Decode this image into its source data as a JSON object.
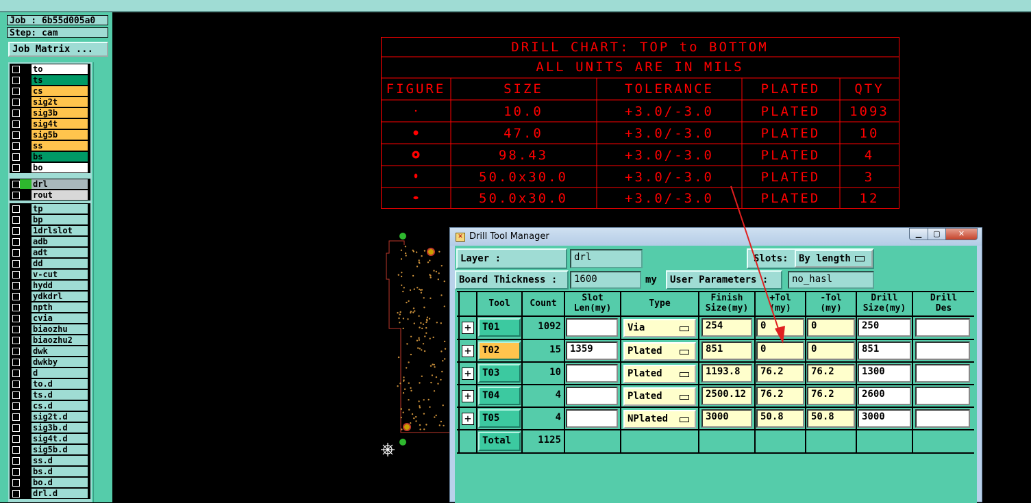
{
  "left_panel": {
    "job_label": "Job : 6b55d005a0",
    "step_label": "Step: cam",
    "job_matrix_btn": "Job Matrix ...",
    "layer_groups": [
      [
        {
          "name": "to",
          "color": "white"
        },
        {
          "name": "ts",
          "color": "teal"
        },
        {
          "name": "cs",
          "color": "orange"
        },
        {
          "name": "sig2t",
          "color": "orange"
        },
        {
          "name": "sig3b",
          "color": "orange"
        },
        {
          "name": "sig4t",
          "color": "orange"
        },
        {
          "name": "sig5b",
          "color": "orange"
        },
        {
          "name": "ss",
          "color": "orange"
        },
        {
          "name": "bs",
          "color": "teal"
        },
        {
          "name": "bo",
          "color": "white"
        }
      ],
      [
        {
          "name": "drl",
          "color": "gray",
          "active": true
        },
        {
          "name": "rout",
          "color": "lgray"
        }
      ],
      [
        {
          "name": "tp",
          "color": "light"
        },
        {
          "name": "bp",
          "color": "light"
        },
        {
          "name": "1drlslot",
          "color": "light"
        },
        {
          "name": "adb",
          "color": "light"
        },
        {
          "name": "adt",
          "color": "light"
        },
        {
          "name": "dd",
          "color": "light"
        },
        {
          "name": "v-cut",
          "color": "light"
        },
        {
          "name": "hydd",
          "color": "light"
        },
        {
          "name": "ydkdrl",
          "color": "light"
        },
        {
          "name": "npth",
          "color": "light"
        },
        {
          "name": "cvia",
          "color": "light"
        },
        {
          "name": "biaozhu",
          "color": "light"
        },
        {
          "name": "biaozhu2",
          "color": "light"
        },
        {
          "name": "dwk",
          "color": "light"
        },
        {
          "name": "dwkby",
          "color": "light"
        },
        {
          "name": "d",
          "color": "light"
        },
        {
          "name": "to.d",
          "color": "light"
        },
        {
          "name": "ts.d",
          "color": "light"
        },
        {
          "name": "cs.d",
          "color": "light"
        },
        {
          "name": "sig2t.d",
          "color": "light"
        },
        {
          "name": "sig3b.d",
          "color": "light"
        },
        {
          "name": "sig4t.d",
          "color": "light"
        },
        {
          "name": "sig5b.d",
          "color": "light"
        },
        {
          "name": "ss.d",
          "color": "light"
        },
        {
          "name": "bs.d",
          "color": "light"
        },
        {
          "name": "bo.d",
          "color": "light"
        },
        {
          "name": "drl.d",
          "color": "light"
        }
      ]
    ]
  },
  "drill_chart": {
    "title": "DRILL CHART: TOP to BOTTOM",
    "subtitle": "ALL UNITS ARE IN MILS",
    "headers": [
      "FIGURE",
      "SIZE",
      "TOLERANCE",
      "PLATED",
      "QTY"
    ],
    "rows": [
      {
        "figure": "dot",
        "size": "10.0",
        "tolerance": "+3.0/-3.0",
        "plated": "PLATED",
        "qty": "1093"
      },
      {
        "figure": "circle",
        "size": "47.0",
        "tolerance": "+3.0/-3.0",
        "plated": "PLATED",
        "qty": "10"
      },
      {
        "figure": "ring",
        "size": "98.43",
        "tolerance": "+3.0/-3.0",
        "plated": "PLATED",
        "qty": "4"
      },
      {
        "figure": "oval-v",
        "size": "50.0x30.0",
        "tolerance": "+3.0/-3.0",
        "plated": "PLATED",
        "qty": "3"
      },
      {
        "figure": "oval-h",
        "size": "50.0x30.0",
        "tolerance": "+3.0/-3.0",
        "plated": "PLATED",
        "qty": "12"
      }
    ],
    "color": "#ff0000"
  },
  "dialog": {
    "title": "Drill Tool Manager",
    "btn_min": "▁",
    "btn_max": "▢",
    "btn_close": "✕",
    "layer_label": "Layer             :",
    "layer_value": "drl",
    "slots_label": "Slots:",
    "slots_value": "By length",
    "board_thickness_label": "Board Thickness :",
    "board_thickness_value": "1600",
    "board_thickness_unit": "my",
    "user_params_label": "User Parameters :",
    "user_params_value": "no_hasl",
    "headers": {
      "tool": "Tool",
      "count": "Count",
      "slot_len": "Slot\nLen(my)",
      "type": "Type",
      "finish": "Finish\nSize(my)",
      "ptol": "+Tol\n(my)",
      "mtol": "-Tol\n(my)",
      "drill_size": "Drill\nSize(my)",
      "drill_des": "Drill\nDes"
    },
    "rows": [
      {
        "idx": "A",
        "tool": "T01",
        "count": "1092",
        "slot_len": "",
        "type": "Via",
        "finish": "254",
        "ptol": "0",
        "mtol": "0",
        "drill_size": "250",
        "drill_des": ""
      },
      {
        "idx": "B",
        "tool": "T02",
        "count": "15",
        "slot_len": "1359",
        "type": "Plated",
        "finish": "851",
        "ptol": "0",
        "mtol": "0",
        "drill_size": "851",
        "drill_des": ""
      },
      {
        "idx": "C",
        "tool": "T03",
        "count": "10",
        "slot_len": "",
        "type": "Plated",
        "finish": "1193.8",
        "ptol": "76.2",
        "mtol": "76.2",
        "drill_size": "1300",
        "drill_des": ""
      },
      {
        "idx": "D",
        "tool": "T04",
        "count": "4",
        "slot_len": "",
        "type": "Plated",
        "finish": "2500.12",
        "ptol": "76.2",
        "mtol": "76.2",
        "drill_size": "2600",
        "drill_des": ""
      },
      {
        "idx": "E",
        "tool": "T05",
        "count": "4",
        "slot_len": "",
        "type": "NPlated",
        "finish": "3000",
        "ptol": "50.8",
        "mtol": "50.8",
        "drill_size": "3000",
        "drill_des": ""
      }
    ],
    "total_label": "Total",
    "total_count": "1125",
    "selected_tool": "T02"
  }
}
